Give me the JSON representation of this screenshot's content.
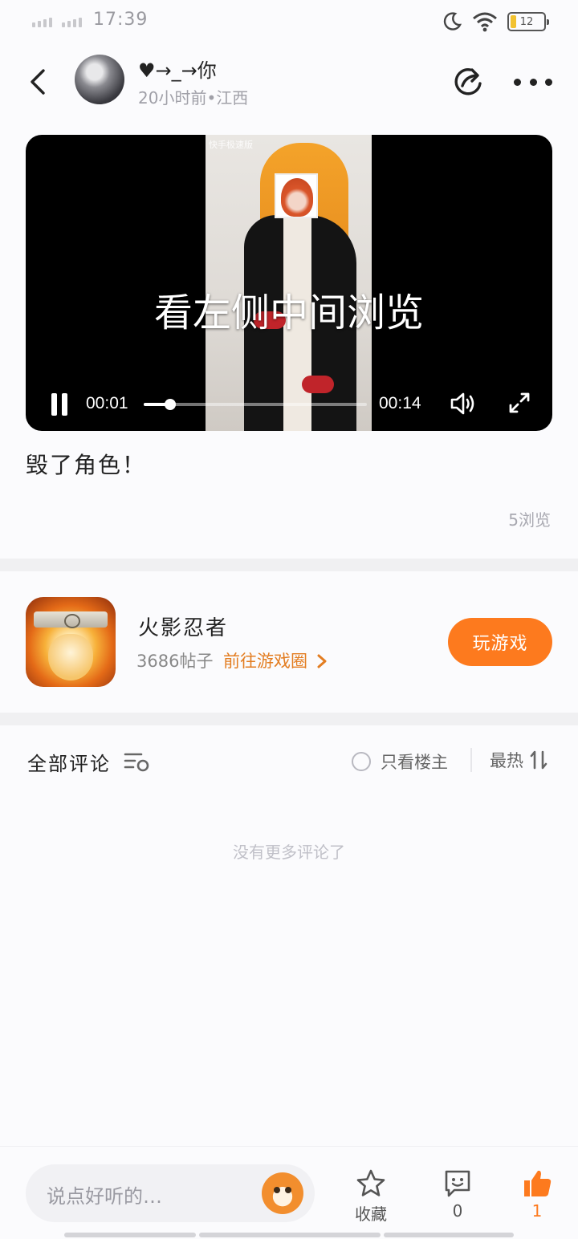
{
  "status_bar": {
    "time": "17:39",
    "battery": "12"
  },
  "header": {
    "username": "♥→_→你",
    "meta": "20小时前•江西"
  },
  "video": {
    "overlay_text": "看左侧中间浏览",
    "watermark": "快手极速版",
    "current_time": "00:01",
    "duration": "00:14",
    "progress": 0.12
  },
  "post": {
    "caption": "毁了角色！",
    "views": "5浏览"
  },
  "game": {
    "name": "火影忍者",
    "posts": "3686帖子",
    "link": "前往游戏圈",
    "play_label": "玩游戏"
  },
  "comments": {
    "title": "全部评论",
    "op_only": "只看楼主",
    "sort": "最热",
    "empty": "没有更多评论了"
  },
  "bottom_bar": {
    "placeholder": "说点好听的…",
    "favorite_label": "收藏",
    "comment_count": "0",
    "like_count": "1"
  },
  "colors": {
    "accent": "#fd7a1e",
    "link": "#e37d21",
    "video_bg": "#000000"
  }
}
